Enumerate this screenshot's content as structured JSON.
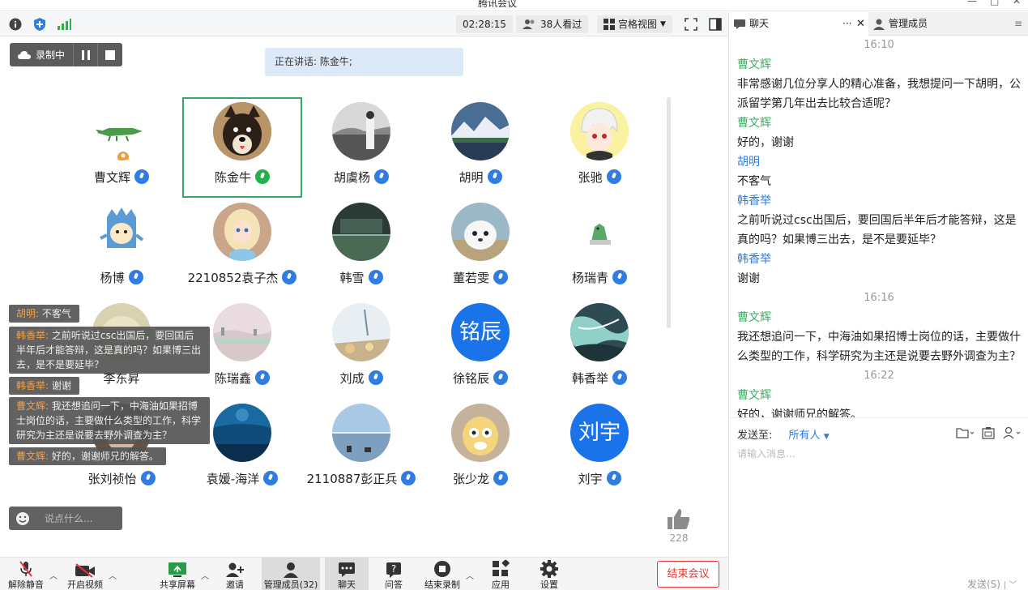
{
  "window": {
    "title": "腾讯会议"
  },
  "toolbar": {
    "timer": "02:28:15",
    "viewers": "38人看过",
    "view_mode": "宫格视图"
  },
  "recording": {
    "label": "录制中"
  },
  "speaking": {
    "text": "正在讲话: 陈金牛;"
  },
  "participants": [
    {
      "name": "曹文辉"
    },
    {
      "name": "陈金牛"
    },
    {
      "name": "胡虞杨"
    },
    {
      "name": "胡明"
    },
    {
      "name": "张驰"
    },
    {
      "name": "杨博"
    },
    {
      "name": "2210852袁子杰"
    },
    {
      "name": "韩雪"
    },
    {
      "name": "董若雯"
    },
    {
      "name": "杨瑞青"
    },
    {
      "name": "李东昇"
    },
    {
      "name": "陈瑞鑫"
    },
    {
      "name": "刘成"
    },
    {
      "name": "徐铭辰",
      "avatar_text": "铭辰"
    },
    {
      "name": "韩香举"
    },
    {
      "name": "张刘祯怡"
    },
    {
      "name": "袁媛-海洋"
    },
    {
      "name": "2110887彭正兵"
    },
    {
      "name": "张少龙"
    },
    {
      "name": "刘宇",
      "avatar_text": "刘宇"
    }
  ],
  "overlay": [
    {
      "who": "胡明:",
      "text": " 不客气"
    },
    {
      "who": "韩香举:",
      "text": " 之前听说过csc出国后，要回国后半年后才能答辩，这是真的吗？如果博三出去，是不是要延毕？"
    },
    {
      "who": "韩香举:",
      "text": " 谢谢"
    },
    {
      "who": "曹文辉:",
      "text": " 我还想追问一下，中海油如果招博士岗位的话，主要做什么类型的工作，科学研究为主还是说要去野外调查为主？"
    },
    {
      "who": "曹文辉:",
      "text": " 好的，谢谢师兄的解答。"
    }
  ],
  "say_placeholder": "说点什么...",
  "likes": "228",
  "bottom": {
    "mute": "解除静音",
    "video": "开启视频",
    "share": "共享屏幕",
    "invite": "邀请",
    "members": "管理成员(32)",
    "chat": "聊天",
    "qa": "问答",
    "stop_rec": "结束录制",
    "apps": "应用",
    "settings": "设置",
    "end": "结束会议"
  },
  "panel": {
    "tab_chat": "聊天",
    "tab_members": "管理成员",
    "send_to_label": "发送至:",
    "send_to_value": "所有人",
    "input_placeholder": "请输入消息...",
    "send_button": "发送(S)"
  },
  "chat": {
    "t1": "16:10",
    "s1": "曹文辉",
    "m1": "非常感谢几位分享人的精心准备，我想提问一下胡明，公派留学第几年出去比较合适呢？",
    "s2": "曹文辉",
    "m2": "好的，谢谢",
    "s3": "胡明",
    "m3": "不客气",
    "s4": "韩香举",
    "m4": "之前听说过csc出国后，要回国后半年后才能答辩，这是真的吗？如果博三出去，是不是要延毕？",
    "s5": "韩香举",
    "m5": "谢谢",
    "t2": "16:16",
    "s6": "曹文辉",
    "m6": "我还想追问一下，中海油如果招博士岗位的话，主要做什么类型的工作，科学研究为主还是说要去野外调查为主？",
    "t3": "16:22",
    "s7": "曹文辉",
    "m7": "好的，谢谢师兄的解答。"
  },
  "colors": {
    "accent": "#2f7de1",
    "speaker_green": "#34a869",
    "end_red": "#ee3333",
    "sender_green": "#3cae64"
  }
}
